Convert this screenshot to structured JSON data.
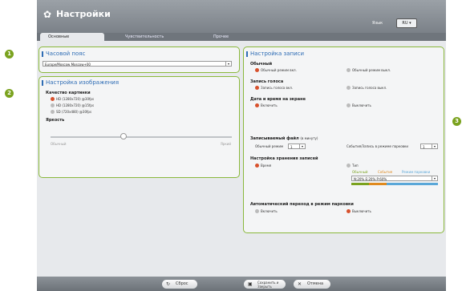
{
  "app": {
    "title": "Настройки",
    "language_label": "Язык",
    "language_button": "RU ▾"
  },
  "tabs": [
    "Основные",
    "Чувствительность",
    "Прочее"
  ],
  "callouts": [
    "1",
    "2",
    "3"
  ],
  "timezone": {
    "title": "Часовой пояс",
    "value": "Europe/Moscow Moscow+00"
  },
  "image": {
    "title": "Настройка изображения",
    "quality_label": "Качество картинки",
    "quality_options": [
      "HD (1280x720) @30fps",
      "HD (1280x720) @15fps",
      "SD (720x480) @30fps"
    ],
    "brightness_label": "Яркость",
    "brightness_min": "Обычный",
    "brightness_max": "Яркий",
    "brightness_level": 0.4
  },
  "record": {
    "title": "Настройка записи",
    "normal_label": "Обычный",
    "normal_options": [
      "Обычный режим вкл.",
      "Обычный режим выкл."
    ],
    "voice_label": "Запись голоса",
    "voice_options": [
      "Запись голоса вкл.",
      "Запись голоса выкл."
    ],
    "datetime_label": "Дата и время на экране",
    "datetime_options": [
      "Включить",
      "Выключить"
    ],
    "file_label": "Записываемый файл",
    "file_unit": "(в минуту)",
    "file_normal_label": "Обычный режим",
    "file_normal_value": "1",
    "file_event_label": "События/Запись в режиме парковки",
    "file_event_value": "1",
    "storage_label": "Настройка хранения записей",
    "storage_options": [
      "Время",
      "Тип"
    ],
    "storage_legend": [
      "Обычный",
      "События",
      "Режим парковки"
    ],
    "storage_value": "N:20% E:20% P:60%",
    "parking_label": "Автоматический переход в режим парковки",
    "parking_options": [
      "Включить",
      "Выключить"
    ]
  },
  "footer": {
    "reset": "Сброс",
    "save": "Сохранить и Закрыть",
    "cancel": "Отмена"
  },
  "colors": {
    "accent_green": "#8ab83b",
    "title_blue": "#2f6db5",
    "radio_on": "#d7512c"
  }
}
